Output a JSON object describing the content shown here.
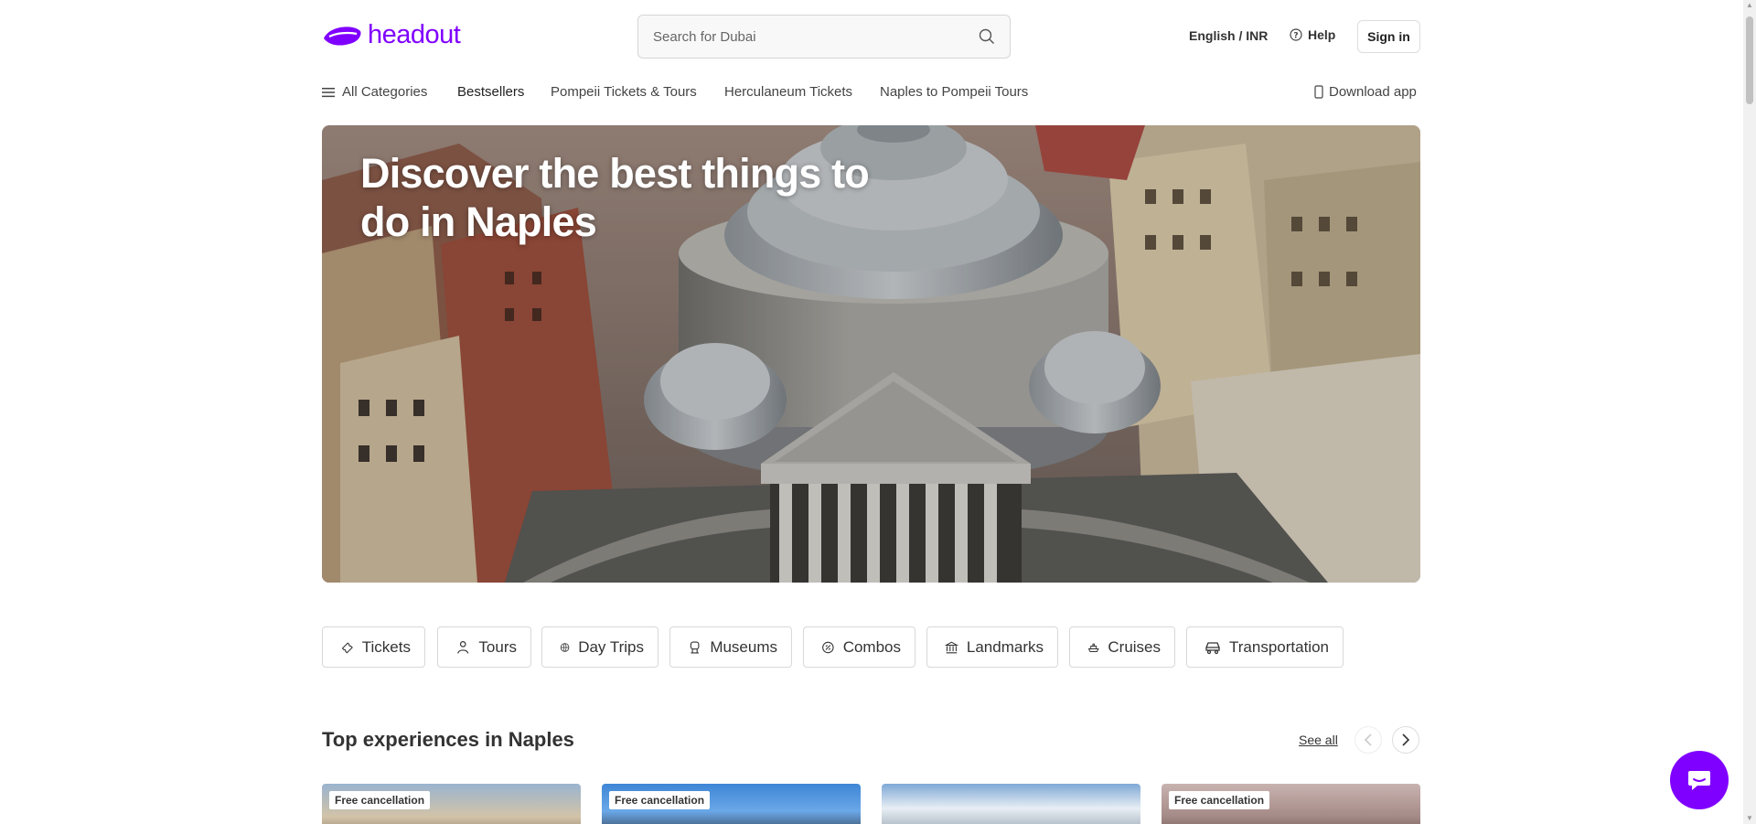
{
  "header": {
    "logo_text": "headout",
    "search_placeholder": "Search for Dubai",
    "language_currency": "English / INR",
    "help_label": "Help",
    "signin_label": "Sign in"
  },
  "nav": {
    "items": [
      {
        "label": "All Categories",
        "icon": "hamburger-icon"
      },
      {
        "label": "Bestsellers"
      },
      {
        "label": "Pompeii Tickets & Tours"
      },
      {
        "label": "Herculaneum Tickets"
      },
      {
        "label": "Naples to Pompeii Tours"
      }
    ],
    "download_label": "Download app"
  },
  "hero": {
    "title": "Discover the best things to do in Naples"
  },
  "categories": [
    {
      "label": "Tickets",
      "icon": "ticket-icon"
    },
    {
      "label": "Tours",
      "icon": "tours-icon"
    },
    {
      "label": "Day Trips",
      "icon": "day-trips-icon"
    },
    {
      "label": "Museums",
      "icon": "museum-icon"
    },
    {
      "label": "Combos",
      "icon": "combos-icon"
    },
    {
      "label": "Landmarks",
      "icon": "landmark-icon"
    },
    {
      "label": "Cruises",
      "icon": "cruise-icon"
    },
    {
      "label": "Transportation",
      "icon": "transportation-icon"
    }
  ],
  "section": {
    "title": "Top experiences in Naples",
    "see_all_label": "See all"
  },
  "cards": [
    {
      "badge": "Free cancellation"
    },
    {
      "badge": "Free cancellation"
    },
    {
      "badge": ""
    },
    {
      "badge": "Free cancellation"
    }
  ],
  "colors": {
    "brand": "#8000ff"
  }
}
